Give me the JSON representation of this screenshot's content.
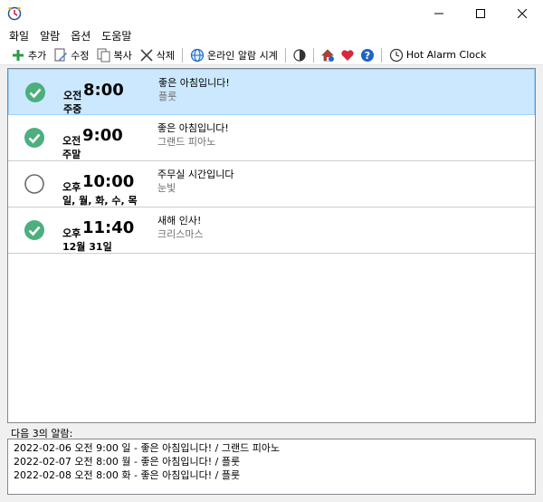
{
  "window": {
    "icon": "clock-icon",
    "controls": [
      "minimize-icon",
      "maximize-icon",
      "close-icon"
    ]
  },
  "menu": [
    "화일",
    "알람",
    "옵션",
    "도움말"
  ],
  "toolbar": {
    "add": "추가",
    "edit": "수정",
    "copy": "복사",
    "delete": "삭제",
    "online_clock": "온라인 알람 시계",
    "app_name": "Hot Alarm Clock"
  },
  "colors": {
    "check_green": "#4caf7d",
    "selected_row": "#cce8ff",
    "plus_green": "#2e9b4e",
    "heart_red": "#d9283b",
    "help_blue": "#1e64c8"
  },
  "alarms": [
    {
      "enabled": true,
      "ampm": "오전",
      "time": "8:00",
      "days": "주중",
      "message": "좋은 아침입니다!",
      "sound": "플룻",
      "selected": true
    },
    {
      "enabled": true,
      "ampm": "오전",
      "time": "9:00",
      "days": "주말",
      "message": "좋은 아침입니다!",
      "sound": "그랜드 피아노",
      "selected": false
    },
    {
      "enabled": false,
      "ampm": "오후",
      "time": "10:00",
      "days": "일, 월, 화, 수, 목",
      "message": "주무실 시간입니다",
      "sound": "눈빛",
      "selected": false
    },
    {
      "enabled": true,
      "ampm": "오후",
      "time": "11:40",
      "days": "12월 31일",
      "message": "새해 인사!",
      "sound": "크리스마스",
      "selected": false
    }
  ],
  "next_alarms": {
    "label": "다음 3의 알람:",
    "items": [
      "2022-02-06 오전 9:00 일 - 좋은 아침입니다! / 그랜드 피아노",
      "2022-02-07 오전 8:00 월 - 좋은 아침입니다! / 플룻",
      "2022-02-08 오전 8:00 화 - 좋은 아침입니다! / 플룻"
    ]
  }
}
